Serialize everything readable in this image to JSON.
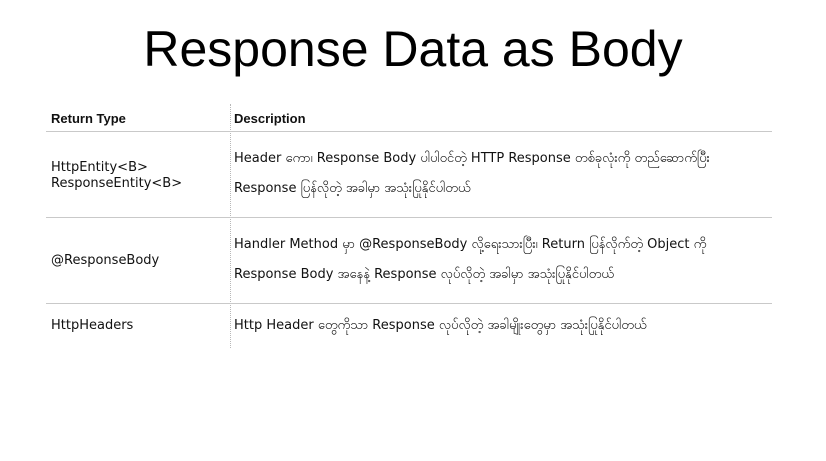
{
  "title": "Response Data as Body",
  "table": {
    "headers": {
      "return_type": "Return Type",
      "description": "Description"
    },
    "rows": [
      {
        "type_lines": [
          "HttpEntity<B>",
          "ResponseEntity<B>"
        ],
        "description_lines": [
          "Header ကော၊ Response Body ပါပါဝင်တဲ့ HTTP Response တစ်ခုလုံးကို တည်ဆောက်ပြီး",
          "Response ပြန်လိုတဲ့ အခါမှာ အသုံးပြုနိုင်ပါတယ်"
        ]
      },
      {
        "type_lines": [
          "@ResponseBody"
        ],
        "description_lines": [
          "Handler Method မှာ @ResponseBody လို့ရေးသားပြီး၊ Return ပြန်လိုက်တဲ့ Object ကို",
          "Response Body အနေနဲ့ Response လုပ်လိုတဲ့ အခါမှာ အသုံးပြုနိုင်ပါတယ်"
        ]
      },
      {
        "type_lines": [
          "HttpHeaders"
        ],
        "description_lines": [
          "Http Header တွေကိုသာ Response လုပ်လိုတဲ့ အခါမျိုးတွေမှာ အသုံးပြုနိုင်ပါတယ်"
        ]
      }
    ]
  }
}
